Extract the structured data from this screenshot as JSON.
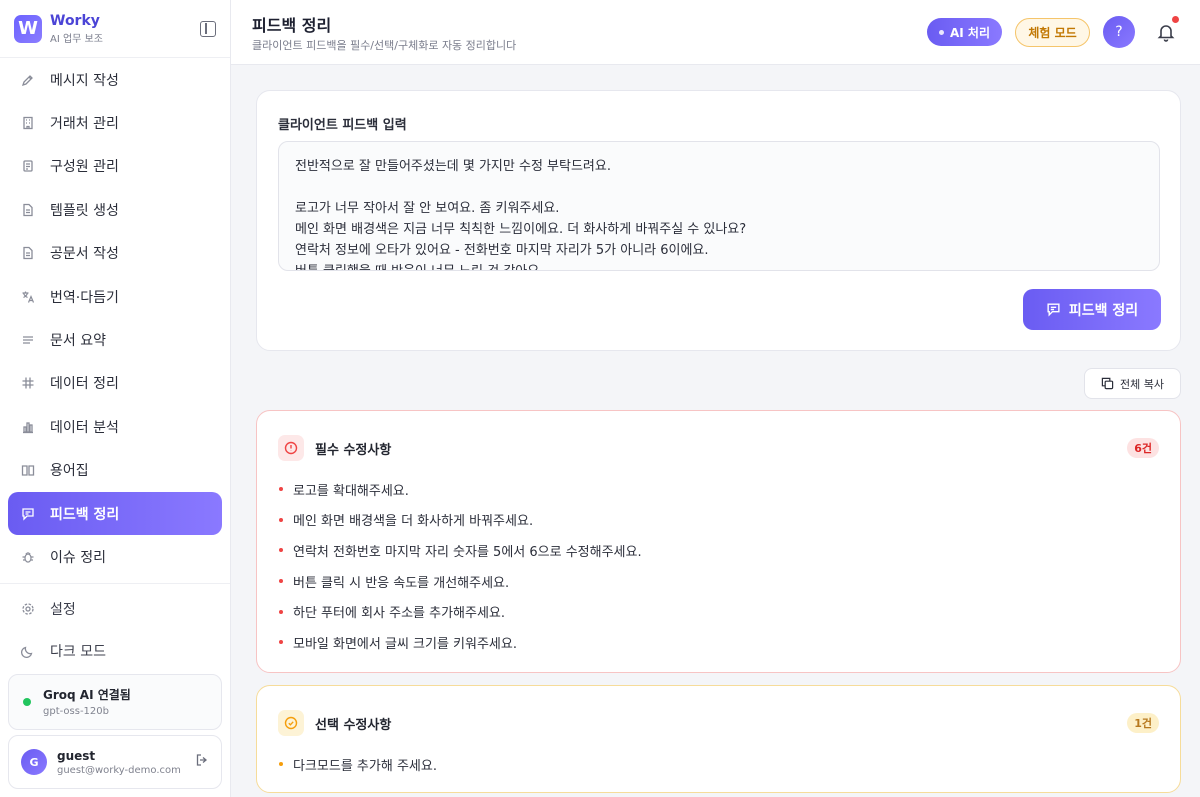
{
  "app": {
    "name": "Worky",
    "subtitle": "AI 업무 보조"
  },
  "sidebar": {
    "items": [
      {
        "label": "메시지 작성",
        "icon": "pencil-icon"
      },
      {
        "label": "거래처 관리",
        "icon": "building-icon"
      },
      {
        "label": "구성원 관리",
        "icon": "people-icon"
      },
      {
        "label": "템플릿 생성",
        "icon": "file-icon"
      },
      {
        "label": "공문서 작성",
        "icon": "document-icon"
      },
      {
        "label": "번역·다듬기",
        "icon": "translate-icon"
      },
      {
        "label": "문서 요약",
        "icon": "lines-icon"
      },
      {
        "label": "데이터 정리",
        "icon": "hash-icon"
      },
      {
        "label": "데이터 분석",
        "icon": "bar-chart-icon"
      },
      {
        "label": "용어집",
        "icon": "book-icon"
      },
      {
        "label": "피드백 정리",
        "icon": "message-icon",
        "active": true
      },
      {
        "label": "이슈 정리",
        "icon": "bug-icon"
      }
    ],
    "bottom": [
      {
        "label": "설정",
        "icon": "gear-icon"
      },
      {
        "label": "다크 모드",
        "icon": "moon-icon"
      }
    ],
    "status": {
      "title": "Groq AI 연결됨",
      "model": "gpt-oss-120b",
      "color": "#22c55e"
    },
    "user": {
      "initial": "G",
      "name": "guest",
      "email": "guest@worky-demo.com"
    }
  },
  "header": {
    "title": "피드백 정리",
    "subtitle": "클라이언트 피드백을 필수/선택/구체화로 자동 정리합니다",
    "ai_label": "AI 처리",
    "trial_label": "체험 모드",
    "help_label": "?"
  },
  "input": {
    "label": "클라이언트 피드백 입력",
    "value": "전반적으로 잘 만들어주셨는데 몇 가지만 수정 부탁드려요.\n\n로고가 너무 작아서 잘 안 보여요. 좀 키워주세요.\n메인 화면 배경색은 지금 너무 칙칙한 느낌이에요. 더 화사하게 바꿔주실 수 있나요?\n연락처 정보에 오타가 있어요 - 전화번호 마지막 자리가 5가 아니라 6이에요.\n버튼 클릭했을 때 반응이 너무 느린 것 같아요.",
    "submit_label": "피드백 정리"
  },
  "copy_all_label": "전체 복사",
  "required": {
    "title": "필수 수정사항",
    "count": "6건",
    "accent": "#ef4444",
    "items": [
      "로고를 확대해주세요.",
      "메인 화면 배경색을 더 화사하게 바꿔주세요.",
      "연락처 전화번호 마지막 자리 숫자를 5에서 6으로 수정해주세요.",
      "버튼 클릭 시 반응 속도를 개선해주세요.",
      "하단 푸터에 회사 주소를 추가해주세요.",
      "모바일 화면에서 글씨 크기를 키워주세요."
    ]
  },
  "optional": {
    "title": "선택 수정사항",
    "count": "1건",
    "accent": "#f59e0b",
    "items": [
      "다크모드를 추가해 주세요."
    ]
  }
}
